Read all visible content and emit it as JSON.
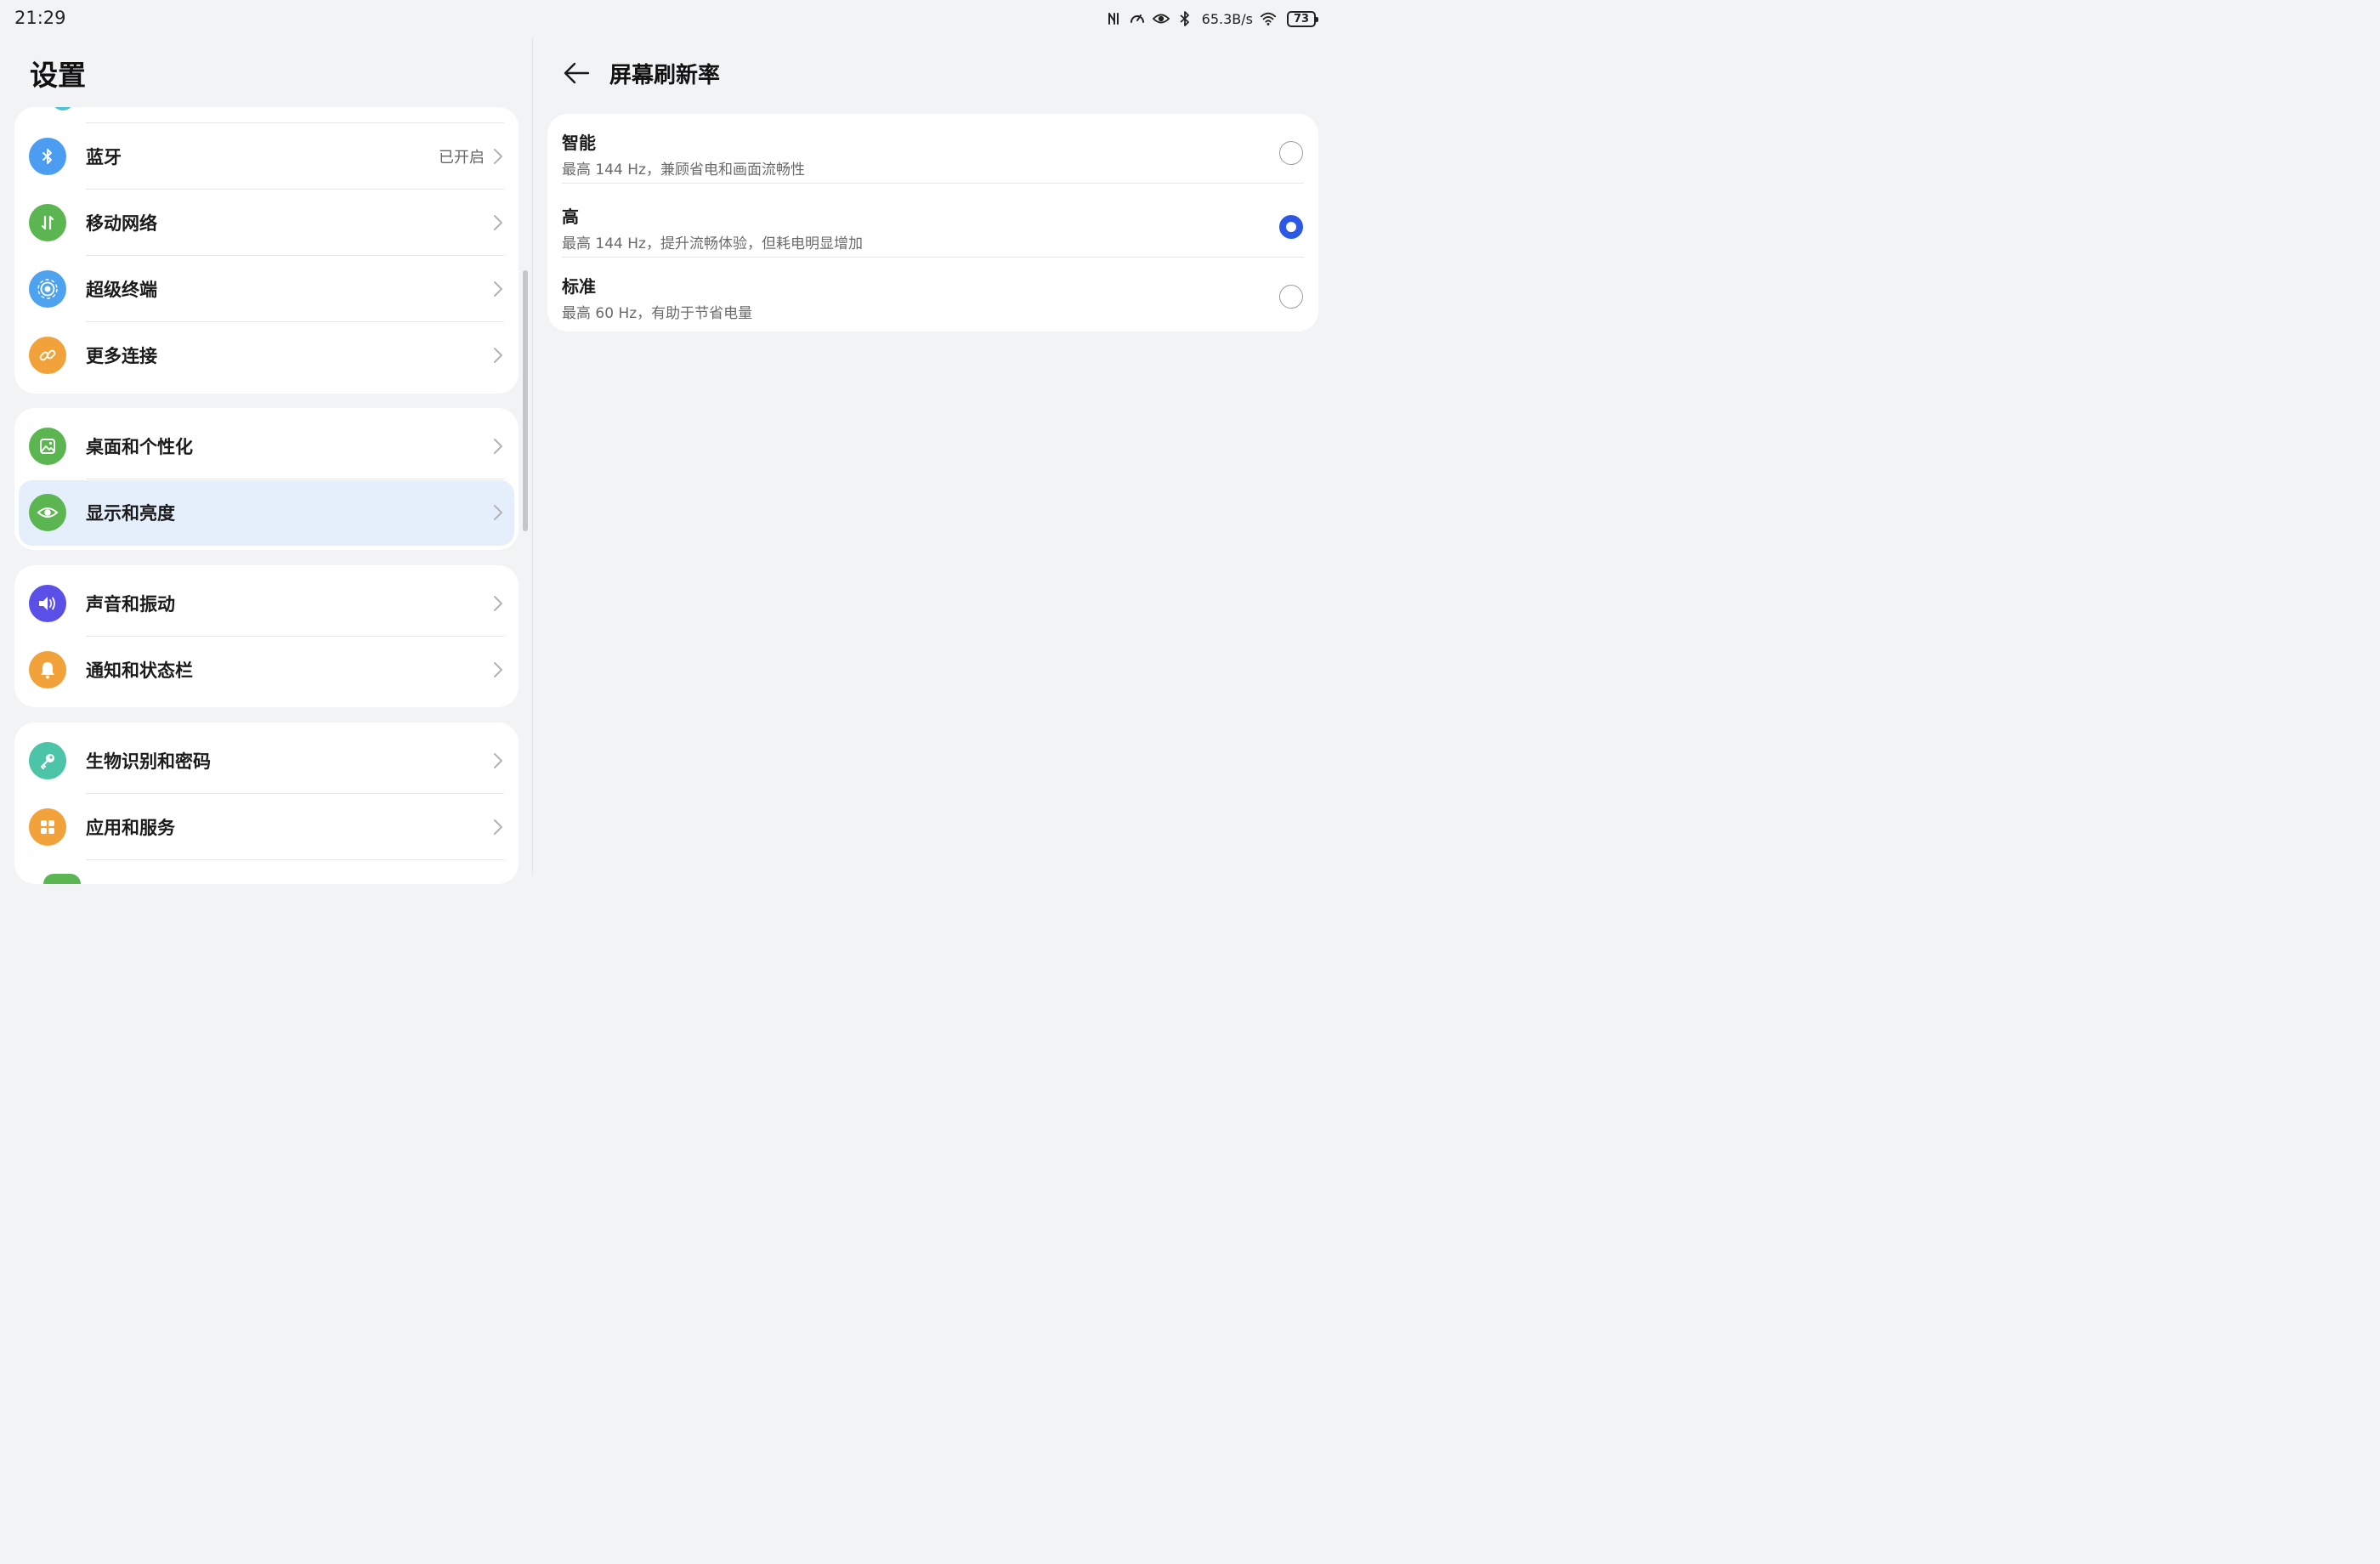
{
  "statusbar": {
    "time": "21:29",
    "net_speed": "65.3B/s",
    "battery": "73",
    "icons": [
      "nfc-icon",
      "speed-icon",
      "eye-comfort-icon",
      "bluetooth-icon",
      "wifi-icon",
      "battery-icon"
    ]
  },
  "left": {
    "title": "设置",
    "groups": [
      {
        "items": [
          {
            "label": "蓝牙",
            "value": "已开启",
            "icon": "bluetooth-icon",
            "color": "#4a9df0"
          },
          {
            "label": "移动网络",
            "value": "",
            "icon": "mobile-data-icon",
            "color": "#5bb651"
          },
          {
            "label": "超级终端",
            "value": "",
            "icon": "super-device-icon",
            "color": "#4ea3ee"
          },
          {
            "label": "更多连接",
            "value": "",
            "icon": "link-icon",
            "color": "#f2a23a"
          }
        ]
      },
      {
        "items": [
          {
            "label": "桌面和个性化",
            "value": "",
            "icon": "wallpaper-icon",
            "color": "#5bb651"
          },
          {
            "label": "显示和亮度",
            "value": "",
            "icon": "eye-icon",
            "color": "#5bb651",
            "selected": true
          }
        ]
      },
      {
        "items": [
          {
            "label": "声音和振动",
            "value": "",
            "icon": "speaker-icon",
            "color": "#5a4fe6"
          },
          {
            "label": "通知和状态栏",
            "value": "",
            "icon": "bell-icon",
            "color": "#f2a23a"
          }
        ]
      },
      {
        "items": [
          {
            "label": "生物识别和密码",
            "value": "",
            "icon": "key-icon",
            "color": "#4cc4a8"
          },
          {
            "label": "应用和服务",
            "value": "",
            "icon": "apps-icon",
            "color": "#f2a23a"
          }
        ]
      }
    ]
  },
  "right": {
    "title": "屏幕刷新率",
    "options": [
      {
        "title": "智能",
        "desc": "最高 144 Hz，兼顾省电和画面流畅性",
        "selected": false
      },
      {
        "title": "高",
        "desc": "最高 144 Hz，提升流畅体验，但耗电明显增加",
        "selected": true
      },
      {
        "title": "标准",
        "desc": "最高 60 Hz，有助于节省电量",
        "selected": false
      }
    ]
  },
  "colors": {
    "accent": "#2b59e6",
    "selected_bg": "#e5effc",
    "background": "#f1f3f5"
  }
}
